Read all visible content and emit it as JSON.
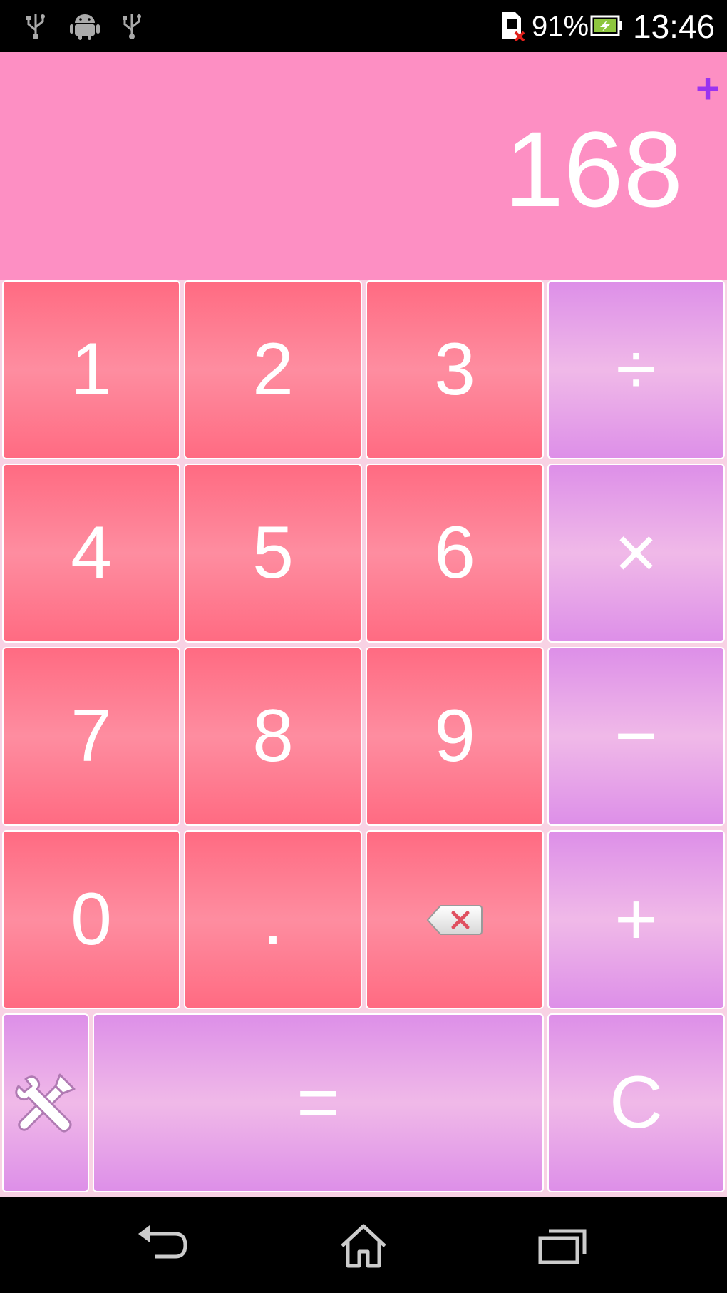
{
  "status_bar": {
    "icons": [
      "usb-icon",
      "android-debug-icon",
      "usb-icon",
      "no-sim-icon",
      "battery-charging-icon"
    ],
    "battery_percent": "91%",
    "time": "13:46"
  },
  "display": {
    "memory_indicator": "+",
    "value": "168"
  },
  "keypad": {
    "key_1": "1",
    "key_2": "2",
    "key_3": "3",
    "key_divide": "÷",
    "key_4": "4",
    "key_5": "5",
    "key_6": "6",
    "key_multiply": "×",
    "key_7": "7",
    "key_8": "8",
    "key_9": "9",
    "key_minus": "−",
    "key_0": "0",
    "key_dot": ".",
    "key_plus": "+",
    "key_equals": "=",
    "key_clear": "C",
    "icons": [
      "backspace-icon",
      "settings-tools-icon"
    ]
  },
  "nav_bar": {
    "icons": [
      "back-icon",
      "home-icon",
      "recents-icon"
    ]
  },
  "colors": {
    "display_bg": "#fd8fc3",
    "number_key": "#ff6b82",
    "operator_key": "#dd8fe8",
    "memory_indicator": "#9a33f0"
  }
}
